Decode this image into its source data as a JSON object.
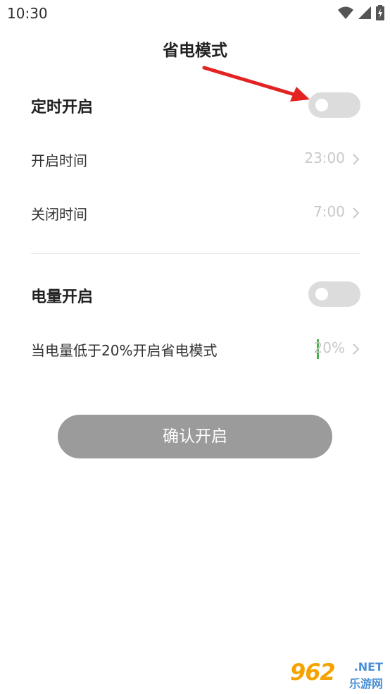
{
  "status_bar": {
    "time": "10:30",
    "icons": [
      "wifi-icon",
      "signal-icon",
      "battery-charging-icon"
    ]
  },
  "header": {
    "title": "省电模式"
  },
  "timed_section": {
    "title": "定时开启",
    "toggle_on": false,
    "rows": [
      {
        "label": "开启时间",
        "value": "23:00"
      },
      {
        "label": "关闭时间",
        "value": "7:00"
      }
    ]
  },
  "battery_section": {
    "title": "电量开启",
    "toggle_on": false,
    "row": {
      "label": "当电量低于20%开启省电模式",
      "value": "20%"
    }
  },
  "confirm_button": {
    "label": "确认开启"
  },
  "watermark": {
    "number": "962",
    "suffix": ".NET",
    "site": "乐游网"
  },
  "colors": {
    "toggle_off": "#dcdcdc",
    "button": "#9b9b9b",
    "value_text": "#c8c8c8",
    "arrow": "#e32222",
    "cursor": "#4caf50"
  }
}
